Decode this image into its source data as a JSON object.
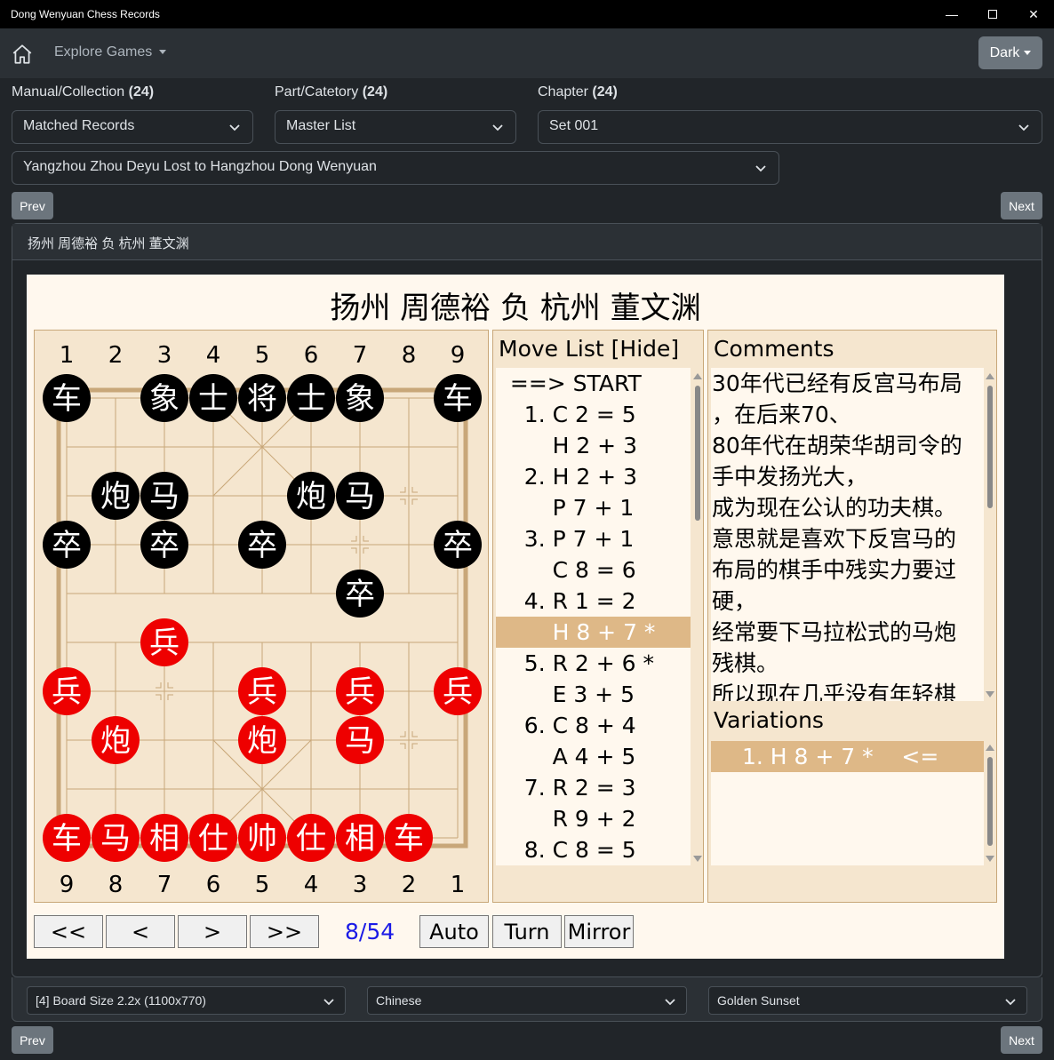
{
  "window": {
    "title": "Dong Wenyuan Chess Records"
  },
  "nav": {
    "explore_label": "Explore Games",
    "theme_label": "Dark"
  },
  "filters": {
    "collection": {
      "label": "Manual/Collection",
      "count": "(24)",
      "value": "Matched Records"
    },
    "part": {
      "label": "Part/Catetory",
      "count": "(24)",
      "value": "Master List"
    },
    "chapter": {
      "label": "Chapter",
      "count": "(24)",
      "value": "Set 001"
    },
    "game": {
      "value": "Yangzhou Zhou Deyu Lost to Hangzhou Dong Wenyuan"
    }
  },
  "pager": {
    "prev": "Prev",
    "next": "Next"
  },
  "card": {
    "header": "扬州 周德裕 负 杭州 董文渊"
  },
  "viewer": {
    "title": "扬州 周德裕 负 杭州 董文渊",
    "top_files": [
      "1",
      "2",
      "3",
      "4",
      "5",
      "6",
      "7",
      "8",
      "9"
    ],
    "bottom_files": [
      "9",
      "8",
      "7",
      "6",
      "5",
      "4",
      "3",
      "2",
      "1"
    ],
    "pieces": [
      {
        "ch": "车",
        "side": "black",
        "file": 0,
        "rank": 0
      },
      {
        "ch": "象",
        "side": "black",
        "file": 2,
        "rank": 0
      },
      {
        "ch": "士",
        "side": "black",
        "file": 3,
        "rank": 0
      },
      {
        "ch": "将",
        "side": "black",
        "file": 4,
        "rank": 0
      },
      {
        "ch": "士",
        "side": "black",
        "file": 5,
        "rank": 0
      },
      {
        "ch": "象",
        "side": "black",
        "file": 6,
        "rank": 0
      },
      {
        "ch": "车",
        "side": "black",
        "file": 8,
        "rank": 0
      },
      {
        "ch": "炮",
        "side": "black",
        "file": 1,
        "rank": 2
      },
      {
        "ch": "马",
        "side": "black",
        "file": 2,
        "rank": 2
      },
      {
        "ch": "炮",
        "side": "black",
        "file": 5,
        "rank": 2
      },
      {
        "ch": "马",
        "side": "black",
        "file": 6,
        "rank": 2
      },
      {
        "ch": "卒",
        "side": "black",
        "file": 0,
        "rank": 3
      },
      {
        "ch": "卒",
        "side": "black",
        "file": 2,
        "rank": 3
      },
      {
        "ch": "卒",
        "side": "black",
        "file": 4,
        "rank": 3
      },
      {
        "ch": "卒",
        "side": "black",
        "file": 8,
        "rank": 3
      },
      {
        "ch": "卒",
        "side": "black",
        "file": 6,
        "rank": 4
      },
      {
        "ch": "兵",
        "side": "red",
        "file": 2,
        "rank": 5
      },
      {
        "ch": "兵",
        "side": "red",
        "file": 0,
        "rank": 6
      },
      {
        "ch": "兵",
        "side": "red",
        "file": 4,
        "rank": 6
      },
      {
        "ch": "兵",
        "side": "red",
        "file": 6,
        "rank": 6
      },
      {
        "ch": "兵",
        "side": "red",
        "file": 8,
        "rank": 6
      },
      {
        "ch": "炮",
        "side": "red",
        "file": 1,
        "rank": 7
      },
      {
        "ch": "炮",
        "side": "red",
        "file": 4,
        "rank": 7
      },
      {
        "ch": "马",
        "side": "red",
        "file": 6,
        "rank": 7
      },
      {
        "ch": "车",
        "side": "red",
        "file": 0,
        "rank": 9
      },
      {
        "ch": "马",
        "side": "red",
        "file": 1,
        "rank": 9
      },
      {
        "ch": "相",
        "side": "red",
        "file": 2,
        "rank": 9
      },
      {
        "ch": "仕",
        "side": "red",
        "file": 3,
        "rank": 9
      },
      {
        "ch": "帅",
        "side": "red",
        "file": 4,
        "rank": 9
      },
      {
        "ch": "仕",
        "side": "red",
        "file": 5,
        "rank": 9
      },
      {
        "ch": "相",
        "side": "red",
        "file": 6,
        "rank": 9
      },
      {
        "ch": "车",
        "side": "red",
        "file": 7,
        "rank": 9
      }
    ],
    "colors": {
      "red": "#ee0000",
      "black": "#000000",
      "highlight": "#deb887",
      "board": "#f5e6cf",
      "board_line": "#c8a779"
    },
    "move_list_header": "Move List [Hide]",
    "moves": [
      "  ==> START",
      "    1. C 2 = 5",
      "        H 2 + 3",
      "    2. H 2 + 3",
      "        P 7 + 1",
      "    3. P 7 + 1",
      "        C 8 = 6",
      "    4. R 1 = 2",
      "        H 8 + 7 *",
      "    5. R 2 + 6 *",
      "        E 3 + 5",
      "    6. C 8 + 4",
      "        A 4 + 5",
      "    7. R 2 = 3",
      "        R 9 + 2",
      "    8. C 8 = 5"
    ],
    "selected_move": 8,
    "comments_header": "Comments",
    "comments": [
      "30年代已经有反宫马布局",
      "，在后来70、",
      "80年代在胡荣华胡司令的",
      "手中发扬光大，",
      "成为现在公认的功夫棋。",
      "意思就是喜欢下反宫马的",
      "布局的棋手中残实力要过",
      "硬，",
      "经常要下马拉松式的马炮",
      "残棋。",
      "所以现在几乎没有年轻棋"
    ],
    "variations_header": "Variations",
    "variations": [
      "1. H 8 + 7 *    <="
    ],
    "controls": {
      "first": "<<",
      "prev": "<",
      "next": ">",
      "last": ">>",
      "counter": "8/54",
      "auto": "Auto",
      "turn": "Turn",
      "mirror": "Mirror"
    }
  },
  "settings": {
    "board_size": "[4] Board Size 2.2x (1100x770)",
    "language": "Chinese",
    "theme": "Golden Sunset"
  }
}
